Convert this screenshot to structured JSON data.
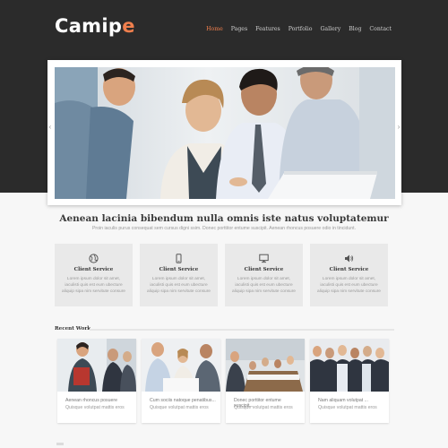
{
  "brand": {
    "name_main": "Camip",
    "name_accent": "e",
    "accent_color": "#f07f4d"
  },
  "nav": [
    {
      "label": "Home",
      "active": true
    },
    {
      "label": "Pages"
    },
    {
      "label": "Features"
    },
    {
      "label": "Portfolio"
    },
    {
      "label": "Gallery"
    },
    {
      "label": "Blog"
    },
    {
      "label": "Contact"
    }
  ],
  "hero": {
    "image": "business-team-photo",
    "prev_icon": "chevron-left-icon",
    "next_icon": "chevron-right-icon"
  },
  "intro": {
    "headline": "Aenean lacinia bibendum nulla omnis iste natus voluptatemur",
    "subline": "Proin iaculis purus consequat sem cursus digni ssim. Donec porttitor entume suscipit. Aenean rhoncus posuere odio in tincidunt."
  },
  "services": [
    {
      "title": "Client Service",
      "icon": "globe-icon",
      "text": "Lorem ipsum dolor sit amet, iaculisti quis est eum ubecture aliquip sipa nim servitute consure"
    },
    {
      "title": "Client Service",
      "icon": "mobile-icon",
      "text": "Lorem ipsum dolor sit amet, iaculisti quis est eum ubecture aliquip sipa nim servitute consure"
    },
    {
      "title": "Client Service",
      "icon": "monitor-icon",
      "text": "Lorem ipsum dolor sit amet, iaculisti quis est eum ubecture aliquip sipa nim servitute consure"
    },
    {
      "title": "Client Service",
      "icon": "speaker-icon",
      "text": "Lorem ipsum dolor sit amet, iaculisti quis est eum ubecture aliquip sipa nim servitute consure"
    }
  ],
  "recent_work": {
    "title": "Recent Work",
    "items": [
      {
        "line1": "Aenean rhoncus posuere",
        "line2": "Quisque volutpat mattis eros"
      },
      {
        "line1": "Cum sociis natoque penatibus...",
        "line2": "Quisque volutpat mattis eros"
      },
      {
        "line1": "Donec porttitor entume suscipit...",
        "line2": "Quisque volutpat mattis eros"
      },
      {
        "line1": "Nam aliquam volutpat ...",
        "line2": "Quisque volutpat mattis eros"
      }
    ]
  }
}
